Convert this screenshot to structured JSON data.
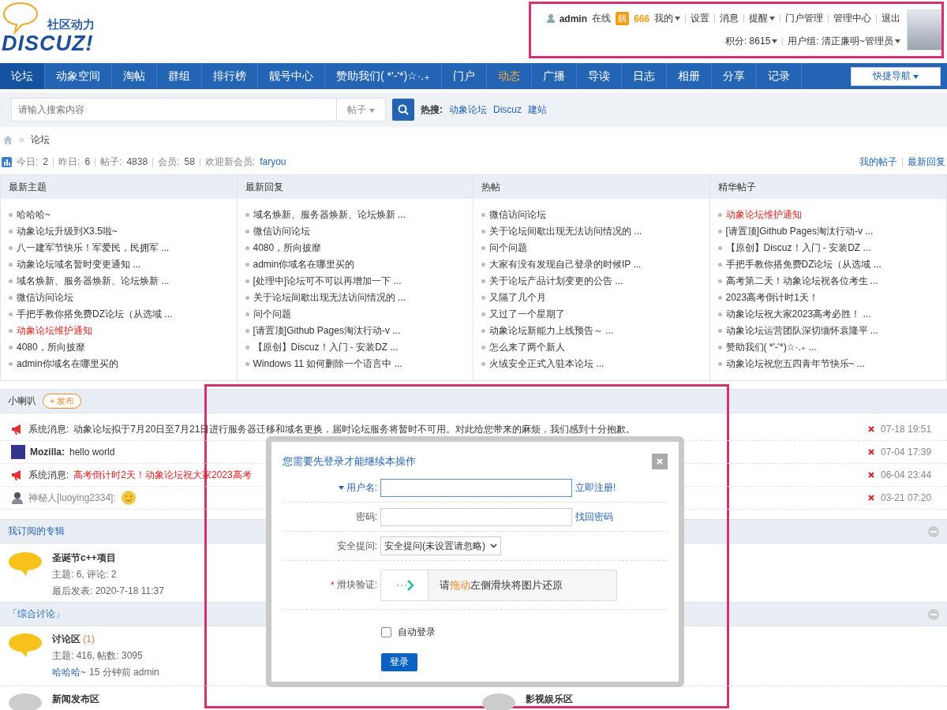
{
  "logo": {
    "tagline": "社区动力",
    "wordmark": "DISCUZ!"
  },
  "user_panel": {
    "username": "admin",
    "status": "在线",
    "badge": "靓",
    "credits": "666",
    "links": [
      {
        "label": "我的",
        "dropdown": true
      },
      {
        "label": "设置",
        "dropdown": false
      },
      {
        "label": "消息",
        "dropdown": false
      },
      {
        "label": "提醒",
        "dropdown": true
      },
      {
        "label": "门户管理",
        "dropdown": false
      },
      {
        "label": "管理中心",
        "dropdown": false
      },
      {
        "label": "退出",
        "dropdown": false
      }
    ],
    "score": "积分: 8615",
    "group": "用户组: 清正廉明~管理员"
  },
  "nav": {
    "items": [
      {
        "label": "论坛",
        "selected": true,
        "highlight": false
      },
      {
        "label": "动象空间",
        "selected": false,
        "highlight": false
      },
      {
        "label": "淘帖",
        "selected": false,
        "highlight": false
      },
      {
        "label": "群组",
        "selected": false,
        "highlight": false
      },
      {
        "label": "排行榜",
        "selected": false,
        "highlight": false
      },
      {
        "label": "靓号中心",
        "selected": false,
        "highlight": false
      },
      {
        "label": "赞助我们( *'-'*)☆·.₊",
        "selected": false,
        "highlight": false
      },
      {
        "label": "门户",
        "selected": false,
        "highlight": false
      },
      {
        "label": "动态",
        "selected": false,
        "highlight": true
      },
      {
        "label": "广播",
        "selected": false,
        "highlight": false
      },
      {
        "label": "导读",
        "selected": false,
        "highlight": false
      },
      {
        "label": "日志",
        "selected": false,
        "highlight": false
      },
      {
        "label": "相册",
        "selected": false,
        "highlight": false
      },
      {
        "label": "分享",
        "selected": false,
        "highlight": false
      },
      {
        "label": "记录",
        "selected": false,
        "highlight": false
      }
    ],
    "quick_nav": "快捷导航"
  },
  "search": {
    "placeholder": "请输入搜索内容",
    "scope": "帖子",
    "hot_label": "热搜:",
    "hot": [
      "动象论坛",
      "Discuz",
      "建站"
    ]
  },
  "breadcrumb_separator": "»",
  "breadcrumb": [
    "论坛"
  ],
  "stats": [
    {
      "label": "今日:",
      "value": "2"
    },
    {
      "label": "昨日:",
      "value": "6"
    },
    {
      "label": "帖子:",
      "value": "4838"
    },
    {
      "label": "会员:",
      "value": "58"
    }
  ],
  "new_member_label": "欢迎新会员:",
  "new_member": "faryou",
  "stats_links": [
    "我的帖子",
    "最新回复"
  ],
  "columns": [
    {
      "title": "最新主题",
      "items": [
        {
          "text": "哈哈哈~",
          "hot": false
        },
        {
          "text": "动象论坛升级到X3.5啦~",
          "hot": false
        },
        {
          "text": "八一建军节快乐！军爱民，民拥军 ...",
          "hot": false
        },
        {
          "text": "动象论坛域名暂时变更通知 ...",
          "hot": false
        },
        {
          "text": "域名焕新、服务器焕新、论坛焕新 ...",
          "hot": false
        },
        {
          "text": "微信访问论坛",
          "hot": false
        },
        {
          "text": "手把手教你搭免费DZ论坛（从选域 ...",
          "hot": false
        },
        {
          "text": "动象论坛维护通知",
          "hot": true
        },
        {
          "text": "4080，所向披靡",
          "hot": false
        },
        {
          "text": "admin你域名在哪里买的",
          "hot": false
        }
      ]
    },
    {
      "title": "最新回复",
      "items": [
        {
          "text": "域名焕新、服务器焕新、论坛焕新 ...",
          "hot": false
        },
        {
          "text": "微信访问论坛",
          "hot": false
        },
        {
          "text": "4080，所向披靡",
          "hot": false
        },
        {
          "text": "admin你域名在哪里买的",
          "hot": false
        },
        {
          "text": "[处理中]论坛可不可以再增加一下 ...",
          "hot": false
        },
        {
          "text": "关于论坛间歇出现无法访问情况的 ...",
          "hot": false
        },
        {
          "text": "问个问题",
          "hot": false
        },
        {
          "text": "[请置顶]Github Pages淘汰行动-v ...",
          "hot": false
        },
        {
          "text": "【原创】Discuz！入门 - 安装DZ ...",
          "hot": false
        },
        {
          "text": "Windows 11 如何删除一个语言中 ...",
          "hot": false
        }
      ]
    },
    {
      "title": "热帖",
      "items": [
        {
          "text": "微信访问论坛",
          "hot": false
        },
        {
          "text": "关于论坛间歇出现无法访问情况的 ...",
          "hot": false
        },
        {
          "text": "问个问题",
          "hot": false
        },
        {
          "text": "大家有没有发现自己登录的时候IP ...",
          "hot": false
        },
        {
          "text": "关于论坛产品计划变更的公告 ...",
          "hot": false
        },
        {
          "text": "又隔了几个月",
          "hot": false
        },
        {
          "text": "又过了一个星期了",
          "hot": false
        },
        {
          "text": "动象论坛新能力上线预告～ ...",
          "hot": false
        },
        {
          "text": "怎么来了两个新人",
          "hot": false
        },
        {
          "text": "火绒安全正式入驻本论坛 ...",
          "hot": false
        }
      ]
    },
    {
      "title": "精华帖子",
      "items": [
        {
          "text": "动象论坛维护通知",
          "hot": true
        },
        {
          "text": "[请置顶]Github Pages淘汰行动-v ...",
          "hot": false
        },
        {
          "text": "【原创】Discuz！入门 - 安装DZ ...",
          "hot": false
        },
        {
          "text": "手把手教你搭免费DZ论坛（从选域 ...",
          "hot": false
        },
        {
          "text": "高考第二天！动象论坛祝各位考生 ...",
          "hot": false
        },
        {
          "text": "2023高考倒计时1天！",
          "hot": false
        },
        {
          "text": "动象论坛祝大家2023高考必胜！ ...",
          "hot": false
        },
        {
          "text": "动象论坛运营团队深切缅怀袁隆平 ...",
          "hot": false
        },
        {
          "text": "赞助我们( *'-'*)☆·.₊ ...",
          "hot": false
        },
        {
          "text": "动象论坛祝您五四青年节快乐~ ...",
          "hot": false
        }
      ]
    }
  ],
  "broadcast": {
    "title": "小喇叭",
    "post_button": "+ 发布",
    "items": [
      {
        "kind": "system",
        "sender": "系统消息:",
        "text": "动象论坛拟于7月20日至7月21日进行服务器迁移和域名更换，届时论坛服务将暂时不可用。对此给您带来的麻烦，我们感到十分抱歉。",
        "hot": false,
        "time": "07-18 19:51"
      },
      {
        "kind": "user",
        "sender": "Mozilla:",
        "text": "hello world",
        "hot": false,
        "time": "07-04 17:39"
      },
      {
        "kind": "system",
        "sender": "系统消息:",
        "text": "高考倒计时2天！动象论坛祝大家2023高考",
        "hot": true,
        "time": "06-04 23:44"
      },
      {
        "kind": "anonymous",
        "sender": "神秘人[luoying2334]:",
        "emoji": true,
        "time": "03-21 07:20"
      }
    ]
  },
  "subscriptions": {
    "title": "我订阅的专辑",
    "items": [
      {
        "title": "圣诞节c++项目",
        "lines": [
          "主题: 6, 评论: 2",
          "最后发表: 2020-7-18 11:37"
        ]
      }
    ]
  },
  "forum_group": {
    "title": "「综合讨论」",
    "forums": [
      {
        "name": "讨论区",
        "count": "(1)",
        "new": true,
        "lines": [
          "主题: 416, 帖数: 3095"
        ],
        "last_post": "哈哈哈~",
        "last_meta": "15 分钟前 admin"
      },
      {
        "name": "新闻发布区",
        "new": false
      },
      {
        "name": "影视娱乐区",
        "new": false
      }
    ]
  },
  "login_dialog": {
    "title": "您需要先登录才能继续本操作",
    "username_label": "用户名:",
    "register_link": "立即注册!",
    "password_label": "密码:",
    "recover_link": "找回密码",
    "question_label": "安全提问:",
    "question_value": "安全提问(未设置请忽略)",
    "slider_required": "*",
    "slider_label": "滑块验证:",
    "slider_hint": [
      {
        "text": "请",
        "emph": false
      },
      {
        "text": "拖动",
        "emph": true
      },
      {
        "text": "左侧滑块将图片还原",
        "emph": false
      }
    ],
    "remember": {
      "label": "自动登录",
      "checked": false
    },
    "submit": "登录"
  }
}
